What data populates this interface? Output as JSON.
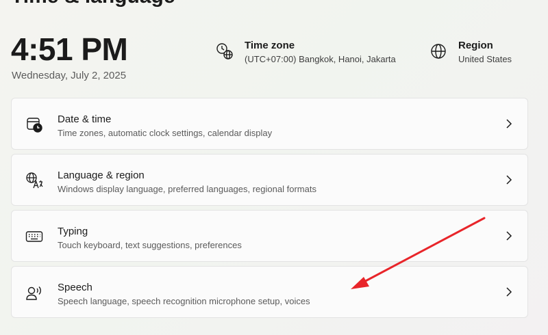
{
  "page": {
    "title": "Time & language"
  },
  "clock": {
    "time": "4:51 PM",
    "date": "Wednesday, July 2, 2025"
  },
  "time_zone": {
    "label": "Time zone",
    "value": "(UTC+07:00) Bangkok, Hanoi, Jakarta",
    "icon": "clock-globe-icon"
  },
  "region": {
    "label": "Region",
    "value": "United States",
    "icon": "globe-icon"
  },
  "settings": [
    {
      "title": "Date & time",
      "subtitle": "Time zones, automatic clock settings, calendar display",
      "icon": "calendar-clock-icon"
    },
    {
      "title": "Language & region",
      "subtitle": "Windows display language, preferred languages, regional formats",
      "icon": "language-icon"
    },
    {
      "title": "Typing",
      "subtitle": "Touch keyboard, text suggestions, preferences",
      "icon": "keyboard-icon"
    },
    {
      "title": "Speech",
      "subtitle": "Speech language, speech recognition microphone setup, voices",
      "icon": "speech-icon"
    }
  ],
  "annotation": {
    "arrow_color": "#e8252a"
  }
}
